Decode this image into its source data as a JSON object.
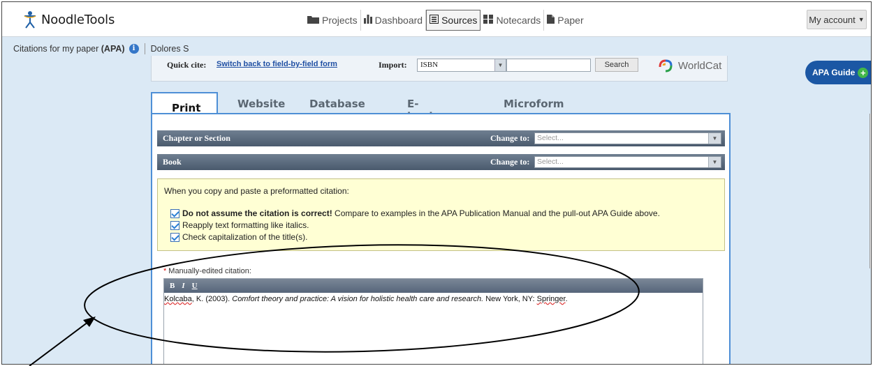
{
  "app": {
    "logo_text": "NoodleTools",
    "nav": [
      {
        "label": "Projects",
        "icon": "folder-icon"
      },
      {
        "label": "Dashboard",
        "icon": "bar-chart-icon"
      },
      {
        "label": "Sources",
        "icon": "list-icon",
        "active": true
      },
      {
        "label": "Notecards",
        "icon": "grid-icon"
      },
      {
        "label": "Paper",
        "icon": "document-icon"
      }
    ],
    "account_label": "My account"
  },
  "subheader": {
    "title_prefix": "Citations for my paper",
    "title_style": "(APA)",
    "user": "Dolores S"
  },
  "quick_cite": {
    "label": "Quick cite:",
    "link": "Switch back to field-by-field form",
    "import_label": "Import:",
    "import_value": "ISBN",
    "search_value": "",
    "search_button": "Search",
    "worldcat": "WorldCat"
  },
  "apa_guide": "APA Guide",
  "tabs": [
    "Print",
    "Website",
    "Database",
    "E-book File",
    "Microform"
  ],
  "sections": [
    {
      "label": "Chapter or Section",
      "change_to": "Change to:",
      "placeholder": "Select..."
    },
    {
      "label": "Book",
      "change_to": "Change to:",
      "placeholder": "Select..."
    }
  ],
  "notice": {
    "head": "When you copy and paste a preformatted citation:",
    "items": [
      {
        "bold": "Do not assume the citation is correct!",
        "rest": " Compare to examples in the APA Publication Manual and the pull-out APA Guide above."
      },
      {
        "bold": "",
        "rest": "Reapply text formatting like italics."
      },
      {
        "bold": "",
        "rest": "Check capitalization of the title(s)."
      }
    ]
  },
  "manual": {
    "required_mark": "*",
    "label": "Manually-edited citation:",
    "toolbar": [
      "B",
      "I",
      "U"
    ],
    "citation_author": "Kolcaba",
    "citation_after_author": ", K. (2003). ",
    "citation_title": "Comfort theory and practice: A vision for holistic health care and research.",
    "citation_publisher_prefix": " New York, NY: ",
    "citation_publisher": "Springer",
    "citation_end": "."
  },
  "colors": {
    "accent": "#4e8fd6",
    "page_bg": "#dbe9f5",
    "apa_guide_bg": "#1b57a4",
    "notice_bg": "#ffffd4"
  }
}
